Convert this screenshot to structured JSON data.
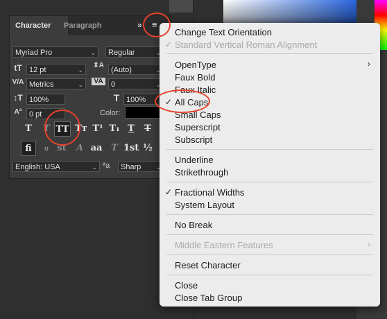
{
  "panel": {
    "tabs": [
      "Character",
      "Paragraph"
    ],
    "collapse": "»",
    "menu_icon": "hamburger-menu-icon",
    "font_family": "Myriad Pro",
    "font_style": "Regular",
    "font_size": "12 pt",
    "leading": "(Auto)",
    "kerning": "Metrics",
    "tracking": "0",
    "vertical_scale": "100%",
    "horizontal_scale": "100%",
    "baseline_shift": "0 pt",
    "color_label": "Color:",
    "color_value": "#000000",
    "style_buttons": [
      "T",
      "T",
      "TT",
      "Tт",
      "T¹",
      "T₁",
      "T",
      "T"
    ],
    "opentype_buttons": [
      "fi",
      "ℴ",
      "st",
      "A",
      "aa",
      "T",
      "1st",
      "½"
    ],
    "language": "English: USA",
    "aa_label": "ªa",
    "antialias": "Sharp"
  },
  "menu": {
    "items": [
      {
        "label": "Change Text Orientation",
        "checked": false,
        "disabled": false
      },
      {
        "label": "Standard Vertical Roman Alignment",
        "checked": true,
        "disabled": true
      },
      {
        "label": "OpenType",
        "checked": false,
        "disabled": false,
        "submenu": true
      },
      {
        "label": "Faux Bold",
        "checked": false,
        "disabled": false
      },
      {
        "label": "Faux Italic",
        "checked": false,
        "disabled": false
      },
      {
        "label": "All Caps",
        "checked": true,
        "disabled": false
      },
      {
        "label": "Small Caps",
        "checked": false,
        "disabled": false
      },
      {
        "label": "Superscript",
        "checked": false,
        "disabled": false
      },
      {
        "label": "Subscript",
        "checked": false,
        "disabled": false
      },
      {
        "label": "Underline",
        "checked": false,
        "disabled": false
      },
      {
        "label": "Strikethrough",
        "checked": false,
        "disabled": false
      },
      {
        "label": "Fractional Widths",
        "checked": true,
        "disabled": false
      },
      {
        "label": "System Layout",
        "checked": false,
        "disabled": false
      },
      {
        "label": "No Break",
        "checked": false,
        "disabled": false
      },
      {
        "label": "Middle Eastern Features",
        "checked": false,
        "disabled": true,
        "submenu": true
      },
      {
        "label": "Reset Character",
        "checked": false,
        "disabled": false
      },
      {
        "label": "Close",
        "checked": false,
        "disabled": false
      },
      {
        "label": "Close Tab Group",
        "checked": false,
        "disabled": false
      }
    ],
    "checkmark": "✓",
    "submenu_arrow": "›"
  },
  "colors": {
    "annotation": "#e8402b",
    "menu_bg": "#ececec",
    "panel_bg": "#3c3c3c"
  }
}
